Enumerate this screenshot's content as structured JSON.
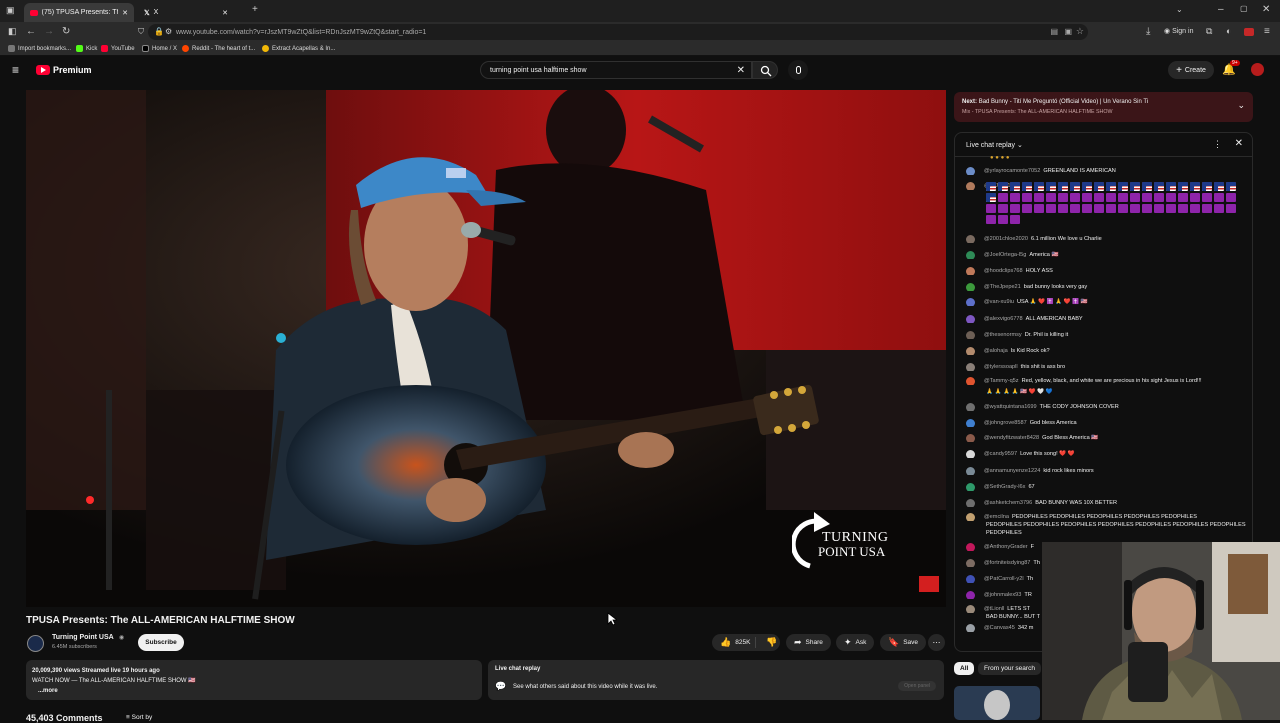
{
  "browser": {
    "tab_title": "(75) TPUSA Presents: The A",
    "tab2_label": "X",
    "url": "www.youtube.com/watch?v=rJszMT9wZtQ&list=RDnJszMT9wZtQ&start_radio=1",
    "bookmarks": [
      "Import bookmarks...",
      "Kick",
      "YouTube",
      "Home / X",
      "Reddit - The heart of t...",
      "Extract Acapellas & In..."
    ],
    "sign_in": "Sign in"
  },
  "youtube": {
    "logo_text": "Premium",
    "search_value": "turning point usa halftime show",
    "create_label": "Create",
    "notif_badge": "9+"
  },
  "video": {
    "watermark_line1": "TURNING",
    "watermark_line2": "POINT USA",
    "title": "TPUSA Presents: The ALL-AMERICAN HALFTIME SHOW",
    "channel": "Turning Point USA",
    "subscribers": "6.45M subscribers",
    "subscribe_label": "Subscribe",
    "likes": "825K",
    "share_label": "Share",
    "ask_label": "Ask",
    "save_label": "Save",
    "description_stats": "20,009,390 views  Streamed live 19 hours ago",
    "description_text": "WATCH NOW — The ALL-AMERICAN HALFTIME SHOW 🇺🇸",
    "more_label": "...more",
    "chat_replay_title": "Live chat replay",
    "chat_replay_desc": "See what others said about this video while it was live.",
    "open_panel_label": "Open panel",
    "comments_count": "45,403 Comments",
    "sort_by_label": "Sort by"
  },
  "side": {
    "next_prefix": "Next:",
    "next_title": "Bad Bunny - Tití Me Preguntó (Official Video) | Un Verano Sin Ti",
    "next_sub": "Mix - TPUSA Presents: The ALL-AMERICAN HALFTIME SHOW",
    "chat_title": "Live chat replay",
    "chips": [
      "All",
      "From your search"
    ]
  },
  "chat_messages": [
    {
      "user": "@yrlayrocamonte7052",
      "text": "GREENLAND IS AMERICAN",
      "color": "#6b8cc7"
    },
    {
      "user": "@GiJane1994",
      "text": "",
      "color": "#b07a5c"
    },
    {
      "user": "@2001chloe2020",
      "text": "6.1 million We love u Charlie",
      "color": "#7a6a60"
    },
    {
      "user": "@JoelOrtega-l5g",
      "text": "America 🇺🇸",
      "color": "#2e8b57"
    },
    {
      "user": "@hoodclips768",
      "text": "HOLY ASS",
      "color": "#c0795a"
    },
    {
      "user": "@TheJpepe21",
      "text": "bad bunny looks very gay",
      "color": "#3c9a3c"
    },
    {
      "user": "@van-xu9iu",
      "text": "USA 🙏 ❤️ ✝️ 🙏 ❤️ ✝️ 🇺🇸",
      "color": "#5d6fc9"
    },
    {
      "user": "@alexvigo6778",
      "text": "ALL AMERICAN BABY",
      "color": "#7e57c2"
    },
    {
      "user": "@thesenormsy",
      "text": "Dr. Phil is killing it",
      "color": "#6d5f55"
    },
    {
      "user": "@alohaja",
      "text": "Is Kid Rock ok?",
      "color": "#b38b6d"
    },
    {
      "user": "@tylerssoapll",
      "text": "this shit is ass bro",
      "color": "#8a7f78"
    },
    {
      "user": "@Tammy-q5z",
      "text": "Red, yellow, black, and white we are precious in his sight Jesus is Lord!!!",
      "color": "#e0542f"
    },
    {
      "user": "@wyattquintana1699",
      "text": "THE CODY JOHNSON COVER",
      "color": "#6f6f6f"
    },
    {
      "user": "@johngrove8587",
      "text": "God bless America",
      "color": "#3f7fcf"
    },
    {
      "user": "@wendyfitzwater8428",
      "text": "God Bless America 🇺🇸",
      "color": "#8a5a4a"
    },
    {
      "user": "@candy9597",
      "text": "Love this song! ❤️ ❤️",
      "color": "#d9d9d9"
    },
    {
      "user": "@annamunyenze1224",
      "text": "kid rock likes minors",
      "color": "#7a8a96"
    },
    {
      "user": "@SethGrady-l6x",
      "text": "67",
      "color": "#2e9a6a"
    },
    {
      "user": "@ashketchem3796",
      "text": "BAD BUNNY WAS 10X BETTER",
      "color": "#6e6e6e"
    },
    {
      "user": "@emcilna",
      "text": "PEDOPHILES PEDOPHILES PEDOPHILES PEDOPHILES PEDOPHILES",
      "color": "#c2a070"
    },
    {
      "user": "@AnthonyGrader",
      "text": "F",
      "color": "#c2185b"
    },
    {
      "user": "@fortniteisdying87",
      "text": "Th",
      "color": "#7d6c63"
    },
    {
      "user": "@PatCarroll-y2l",
      "text": "Th",
      "color": "#3f51b5"
    },
    {
      "user": "@johnmalex93",
      "text": "TR",
      "color": "#8e24aa"
    },
    {
      "user": "@tLionll",
      "text": "LETS ST",
      "color": "#9a8a7a"
    },
    {
      "user": "@Canvas45",
      "text": "342 m",
      "color": "#9aa0a6"
    }
  ],
  "chat_extra": {
    "emcilna_line2": "PEDOPHILES PEDOPHILES PEDOPHILES PEDOPHILES PEDOPHILES PEDOPHILES PEDOPHILES",
    "emcilna_line3": "PEDOPHILES",
    "tammy_line2": "🙏 🙏 🙏 🙏 🇺🇸 ❤️ 🤍 💙",
    "tlion_line2": "BAD BUNNY... BUT T"
  },
  "colors": {
    "accent_red": "#ff0033",
    "next_bg": "#3b1518"
  }
}
